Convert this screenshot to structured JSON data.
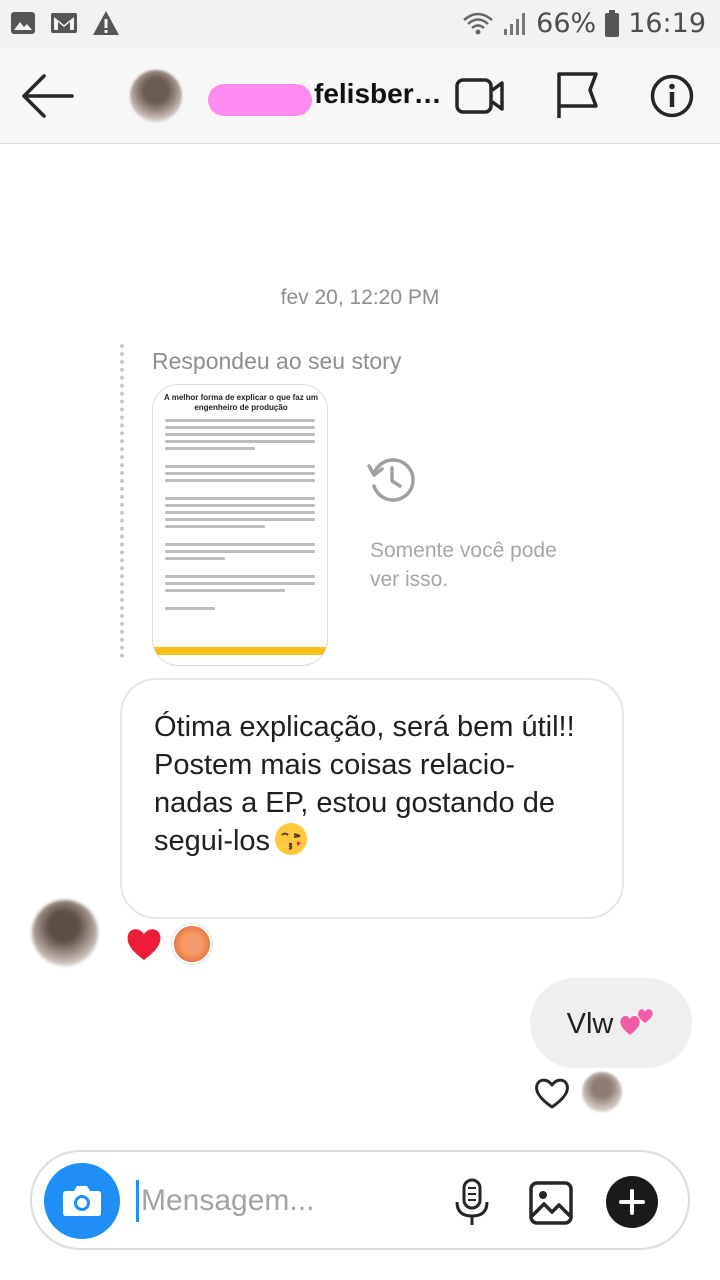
{
  "status_bar": {
    "battery": "66%",
    "time": "16:19",
    "icons": [
      "image-icon",
      "gmail-icon",
      "warning-icon",
      "wifi-icon",
      "signal-icon",
      "battery-icon"
    ]
  },
  "header": {
    "username": "felisber…",
    "icons": [
      "back-arrow-icon",
      "video-call-icon",
      "flag-icon",
      "info-icon"
    ]
  },
  "conversation": {
    "timestamp": "fev 20, 12:20 PM",
    "story_reply": {
      "label": "Respondeu ao seu story",
      "story_title": "A melhor forma de explicar o que faz um engenheiro de produção",
      "only_you_text": "Somente você pode ver isso."
    },
    "received_message": {
      "text": "Ótima explicação, será bem útil!!\nPostem mais coisas relacio-nadas a EP, estou gostando de segui-los",
      "emoji": "kissing-face-emoji",
      "reactions": [
        "heart-reaction",
        "orange-face-reaction"
      ]
    },
    "sent_message": {
      "text": "Vlw",
      "emoji": "two-hearts-emoji"
    }
  },
  "composer": {
    "placeholder": "Mensagem...",
    "accent": "#1f8ff5",
    "icons": [
      "camera-icon",
      "microphone-icon",
      "gallery-icon",
      "plus-icon"
    ]
  }
}
